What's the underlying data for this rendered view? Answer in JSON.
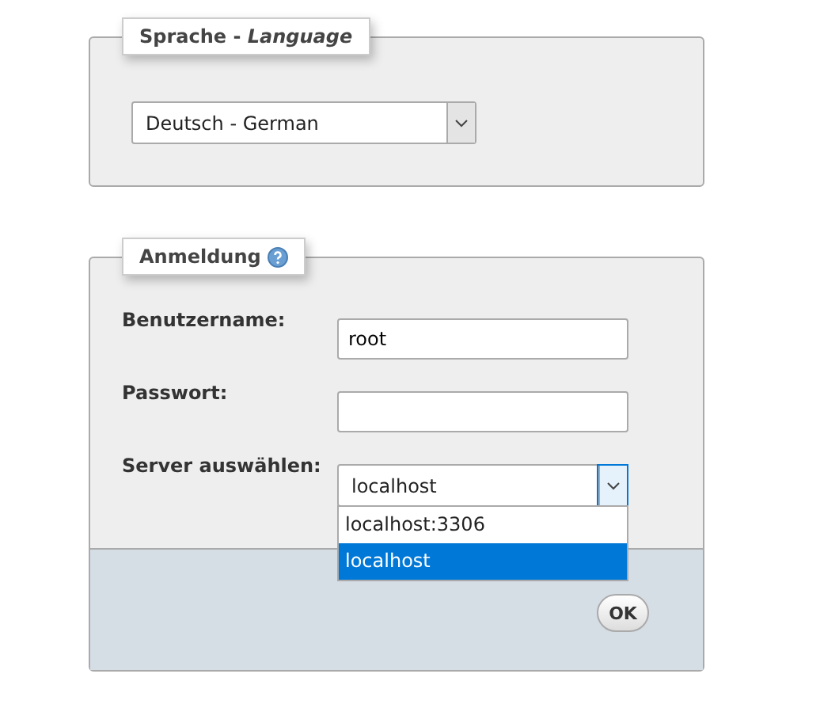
{
  "language": {
    "legend": "Sprache - *Language*",
    "select": {
      "value": "Deutsch - German"
    }
  },
  "login": {
    "legend": "Anmeldung",
    "fields": [
      {
        "label": "Benutzername:",
        "kind": "text",
        "value": "root"
      },
      {
        "label": "Passwort:",
        "kind": "password"
      },
      {
        "label": "Server auswählen:",
        "kind": "select",
        "value": "localhost",
        "expanded": true,
        "options": [
          {
            "label": "localhost:3306",
            "selected": false
          },
          {
            "label": "localhost",
            "selected": true
          }
        ]
      }
    ],
    "submit": "OK"
  }
}
